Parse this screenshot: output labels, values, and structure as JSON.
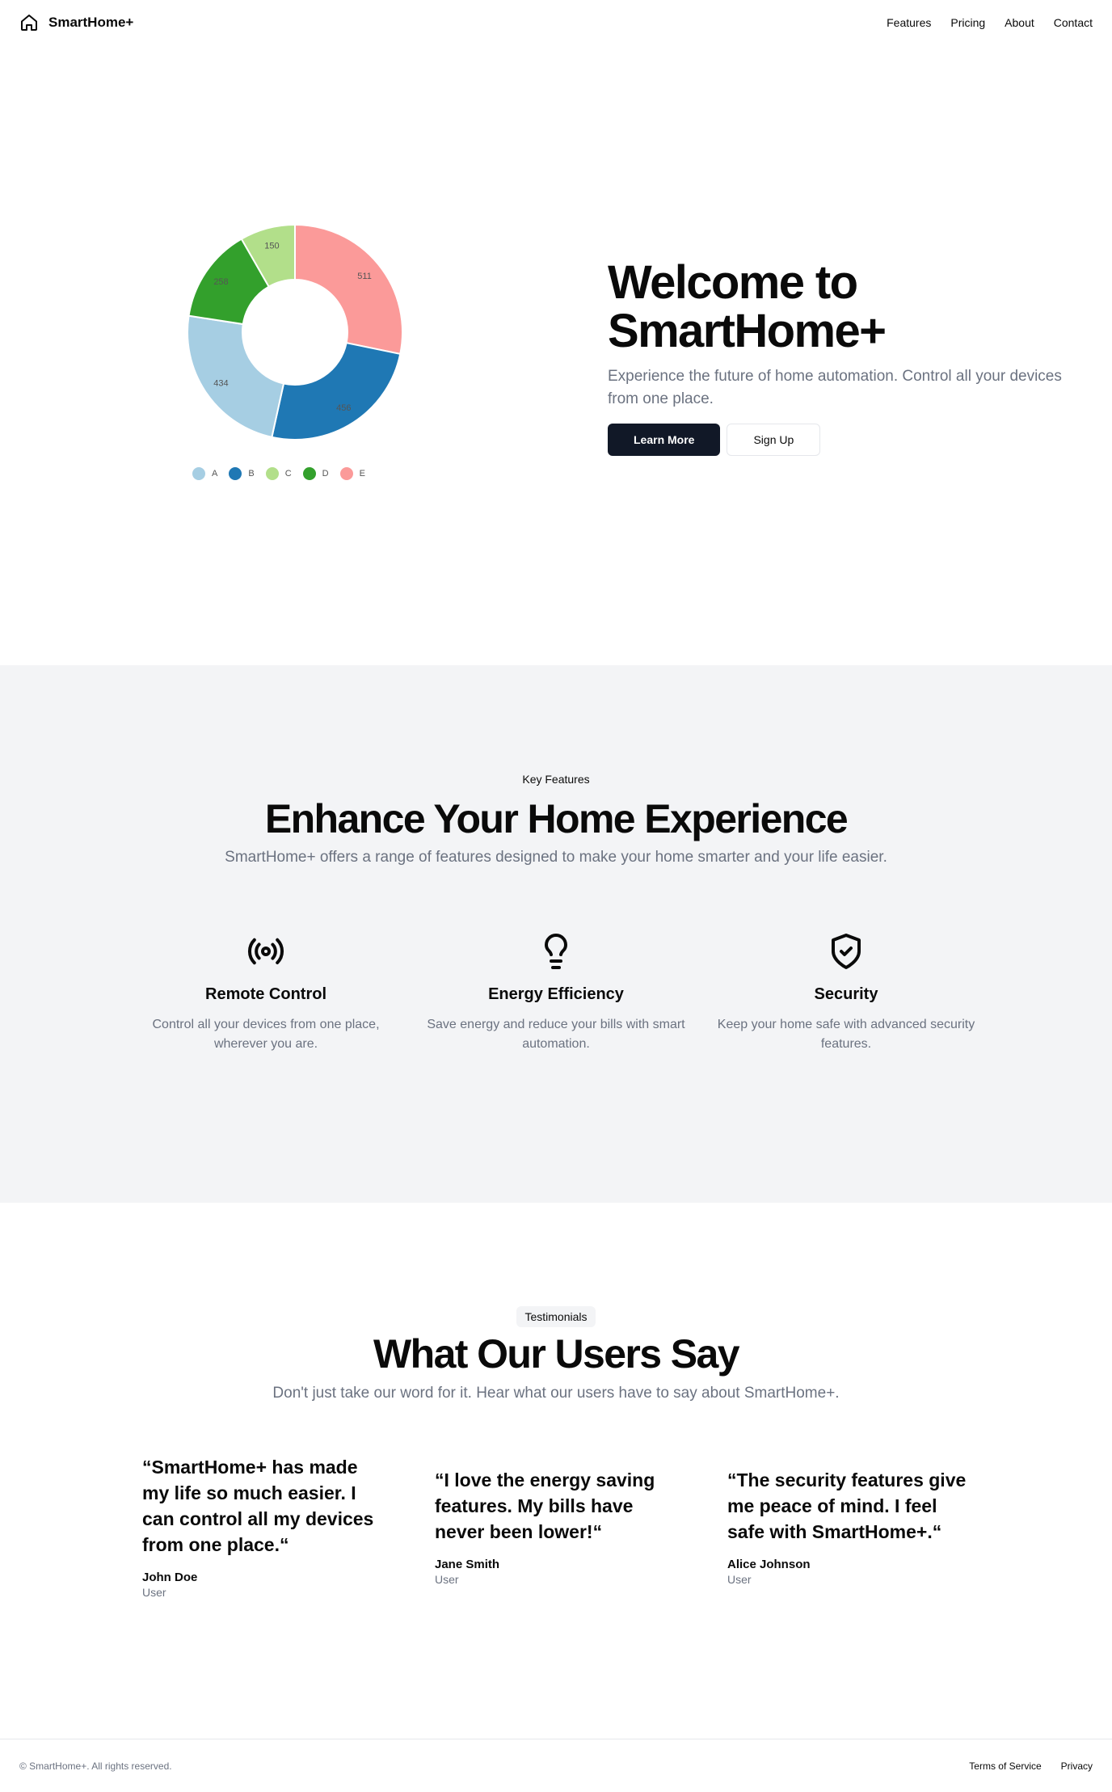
{
  "header": {
    "brand": "SmartHome+",
    "brand_icon": "home-icon",
    "nav": [
      "Features",
      "Pricing",
      "About",
      "Contact"
    ]
  },
  "hero": {
    "title_line1": "Welcome to",
    "title_line2": "SmartHome+",
    "subtitle": "Experience the future of home automation. Control all your devices from one place.",
    "primary_button": "Learn More",
    "secondary_button": "Sign Up"
  },
  "chart_data": {
    "type": "pie",
    "categories": [
      "A",
      "B",
      "C",
      "D",
      "E"
    ],
    "values": [
      434,
      456,
      150,
      258,
      511
    ],
    "slice_order": [
      "E",
      "B",
      "A",
      "D",
      "C"
    ],
    "colors": {
      "A": "#a6cee3",
      "B": "#1f78b4",
      "C": "#b2df8a",
      "D": "#33a02c",
      "E": "#fb9a99"
    },
    "donut": true,
    "data_labels": true,
    "legend": "bottom"
  },
  "features": {
    "eyebrow": "Key Features",
    "title": "Enhance Your Home Experience",
    "subtitle": "SmartHome+ offers a range of features designed to make your home smarter and your life easier.",
    "items": [
      {
        "icon": "radio-icon",
        "name": "Remote Control",
        "desc": "Control all your devices from one place, wherever you are."
      },
      {
        "icon": "lightbulb-icon",
        "name": "Energy Efficiency",
        "desc": "Save energy and reduce your bills with smart automation."
      },
      {
        "icon": "shield-check-icon",
        "name": "Security",
        "desc": "Keep your home safe with advanced security features."
      }
    ]
  },
  "testimonials": {
    "badge": "Testimonials",
    "title": "What Our Users Say",
    "subtitle": "Don't just take our word for it. Hear what our users have to say about SmartHome+.",
    "items": [
      {
        "quote": "“SmartHome+ has made my life so much easier. I can control all my devices from one place.“",
        "author": "John Doe",
        "role": "User"
      },
      {
        "quote": "“I love the energy saving features. My bills have never been lower!“",
        "author": "Jane Smith",
        "role": "User"
      },
      {
        "quote": "“The security features give me peace of mind. I feel safe with SmartHome+.“",
        "author": "Alice Johnson",
        "role": "User"
      }
    ]
  },
  "footer": {
    "copyright": "© SmartHome+. All rights reserved.",
    "links": [
      "Terms of Service",
      "Privacy"
    ]
  }
}
